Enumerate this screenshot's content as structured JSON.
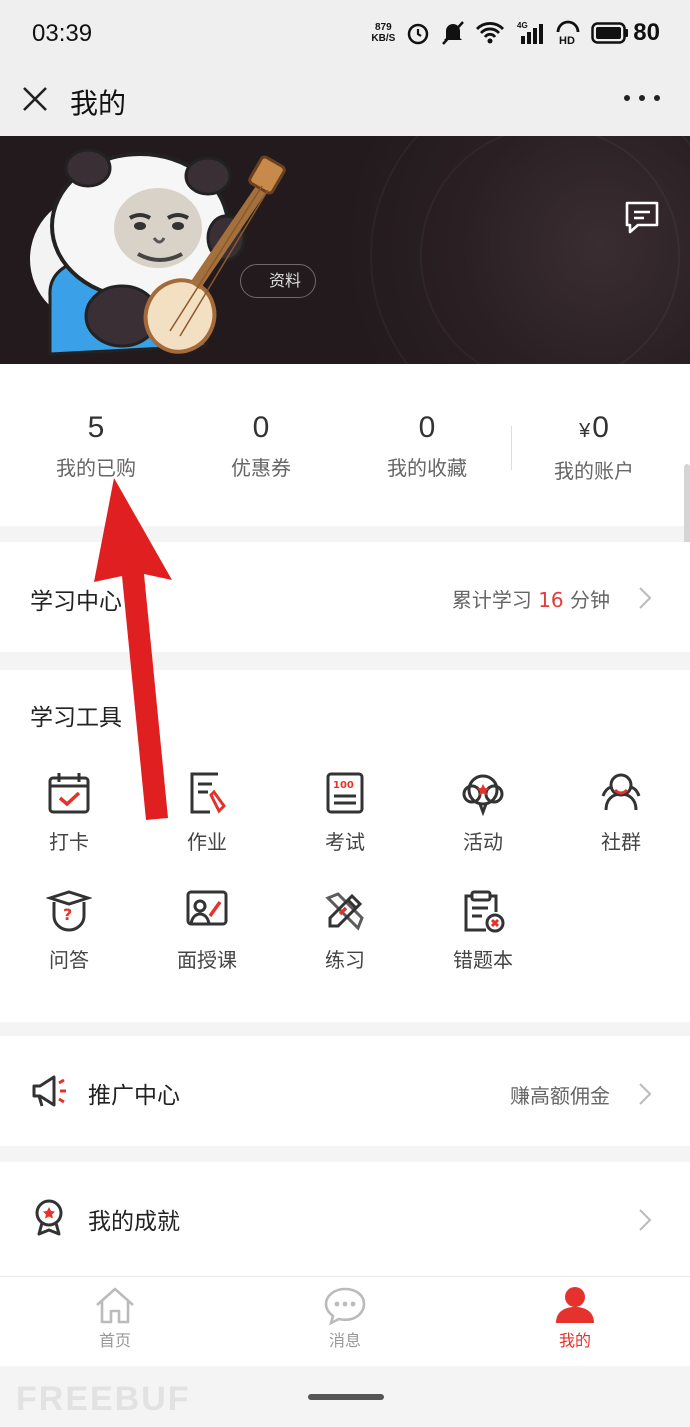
{
  "status_bar": {
    "time": "03:39",
    "speed_value": "879",
    "speed_unit": "KB/S",
    "network_label": "4G",
    "hd_label": "HD",
    "battery": "80"
  },
  "nav": {
    "title": "我的"
  },
  "profile": {
    "edit_button_label": "资料"
  },
  "stats": [
    {
      "value": "5",
      "label": "我的已购"
    },
    {
      "value": "0",
      "label": "优惠券"
    },
    {
      "value": "0",
      "label": "我的收藏"
    },
    {
      "currency": "¥",
      "value": "0",
      "label": "我的账户"
    }
  ],
  "study_center": {
    "title": "学习中心",
    "summary_prefix": "累计学习",
    "minutes": "16",
    "summary_suffix": "分钟"
  },
  "study_tools": {
    "title": "学习工具",
    "items": [
      {
        "label": "打卡",
        "icon": "calendar-check-icon"
      },
      {
        "label": "作业",
        "icon": "homework-icon"
      },
      {
        "label": "考试",
        "icon": "exam-icon"
      },
      {
        "label": "活动",
        "icon": "activity-icon"
      },
      {
        "label": "社群",
        "icon": "community-icon"
      },
      {
        "label": "问答",
        "icon": "qa-icon"
      },
      {
        "label": "面授课",
        "icon": "classroom-icon"
      },
      {
        "label": "练习",
        "icon": "practice-icon"
      },
      {
        "label": "错题本",
        "icon": "mistake-book-icon"
      }
    ]
  },
  "promotion": {
    "title": "推广中心",
    "hint": "赚高额佣金"
  },
  "achievement": {
    "title": "我的成就"
  },
  "tab_bar": {
    "items": [
      {
        "label": "首页",
        "icon": "home-icon",
        "active": false
      },
      {
        "label": "消息",
        "icon": "message-icon",
        "active": false
      },
      {
        "label": "我的",
        "icon": "profile-icon",
        "active": true
      }
    ]
  },
  "watermark": "FREEBUF",
  "colors": {
    "accent": "#e5322d",
    "highlight": "#e43c3c",
    "header_bg": "#2a2024"
  }
}
